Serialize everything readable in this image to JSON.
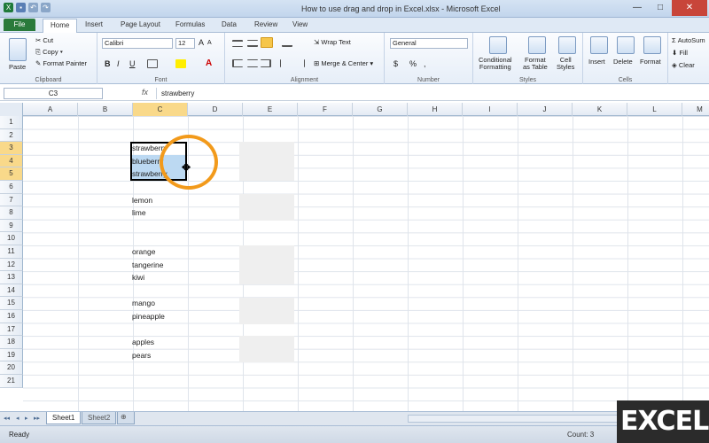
{
  "window": {
    "title": "How to use drag and drop in Excel.xlsx - Microsoft Excel"
  },
  "tabs": [
    "File",
    "Home",
    "Insert",
    "Page Layout",
    "Formulas",
    "Data",
    "Review",
    "View"
  ],
  "active_tab": "Home",
  "ribbon": {
    "clipboard": {
      "label": "Clipboard",
      "paste": "Paste",
      "cut": "Cut",
      "copy": "Copy",
      "copy_arrow": "▾",
      "format_painter": "Format Painter"
    },
    "font": {
      "label": "Font",
      "name": "Calibri",
      "size": "12",
      "bold": "B",
      "italic": "I",
      "underline": "U",
      "grow": "A",
      "shrink": "A",
      "font_color": "A"
    },
    "alignment": {
      "label": "Alignment",
      "wrap_text": "Wrap Text",
      "merge_center": "Merge & Center"
    },
    "number": {
      "label": "Number",
      "format": "General",
      "currency": "$",
      "percent": "%",
      "comma": ","
    },
    "styles": {
      "label": "Styles",
      "conditional": "Conditional",
      "conditional2": "Formatting",
      "format_table": "Format",
      "format_table2": "as Table",
      "cell_styles": "Cell",
      "cell_styles2": "Styles"
    },
    "cells": {
      "label": "Cells",
      "insert": "Insert",
      "delete": "Delete",
      "format": "Format"
    },
    "editing": {
      "autosum": "AutoSum",
      "fill": "Fill",
      "clear": "Clear"
    }
  },
  "formula_bar": {
    "name_box": "C3",
    "fx": "fx",
    "value": "strawberry"
  },
  "columns": [
    "A",
    "B",
    "C",
    "D",
    "E",
    "F",
    "G",
    "H",
    "I",
    "J",
    "K",
    "L",
    "M"
  ],
  "selected_column": "C",
  "rows": [
    "1",
    "2",
    "3",
    "4",
    "5",
    "6",
    "7",
    "8",
    "9",
    "10",
    "11",
    "12",
    "13",
    "14",
    "15",
    "16",
    "17",
    "18",
    "19",
    "20",
    "21"
  ],
  "selected_rows": [
    "3",
    "4",
    "5"
  ],
  "cells": [
    {
      "row": 3,
      "text": "strawberry"
    },
    {
      "row": 4,
      "text": "blueberry"
    },
    {
      "row": 5,
      "text": "strawberry"
    },
    {
      "row": 7,
      "text": "lemon"
    },
    {
      "row": 8,
      "text": "lime"
    },
    {
      "row": 11,
      "text": "orange"
    },
    {
      "row": 12,
      "text": "tangerine"
    },
    {
      "row": 13,
      "text": "kiwi"
    },
    {
      "row": 15,
      "text": "mango"
    },
    {
      "row": 16,
      "text": "pineapple"
    },
    {
      "row": 18,
      "text": "apples"
    },
    {
      "row": 19,
      "text": "pears"
    }
  ],
  "sheets": [
    "Sheet1",
    "Sheet2"
  ],
  "active_sheet": "Sheet1",
  "status": {
    "ready": "Ready",
    "count": "Count: 3"
  },
  "watermark": "EXCEL"
}
